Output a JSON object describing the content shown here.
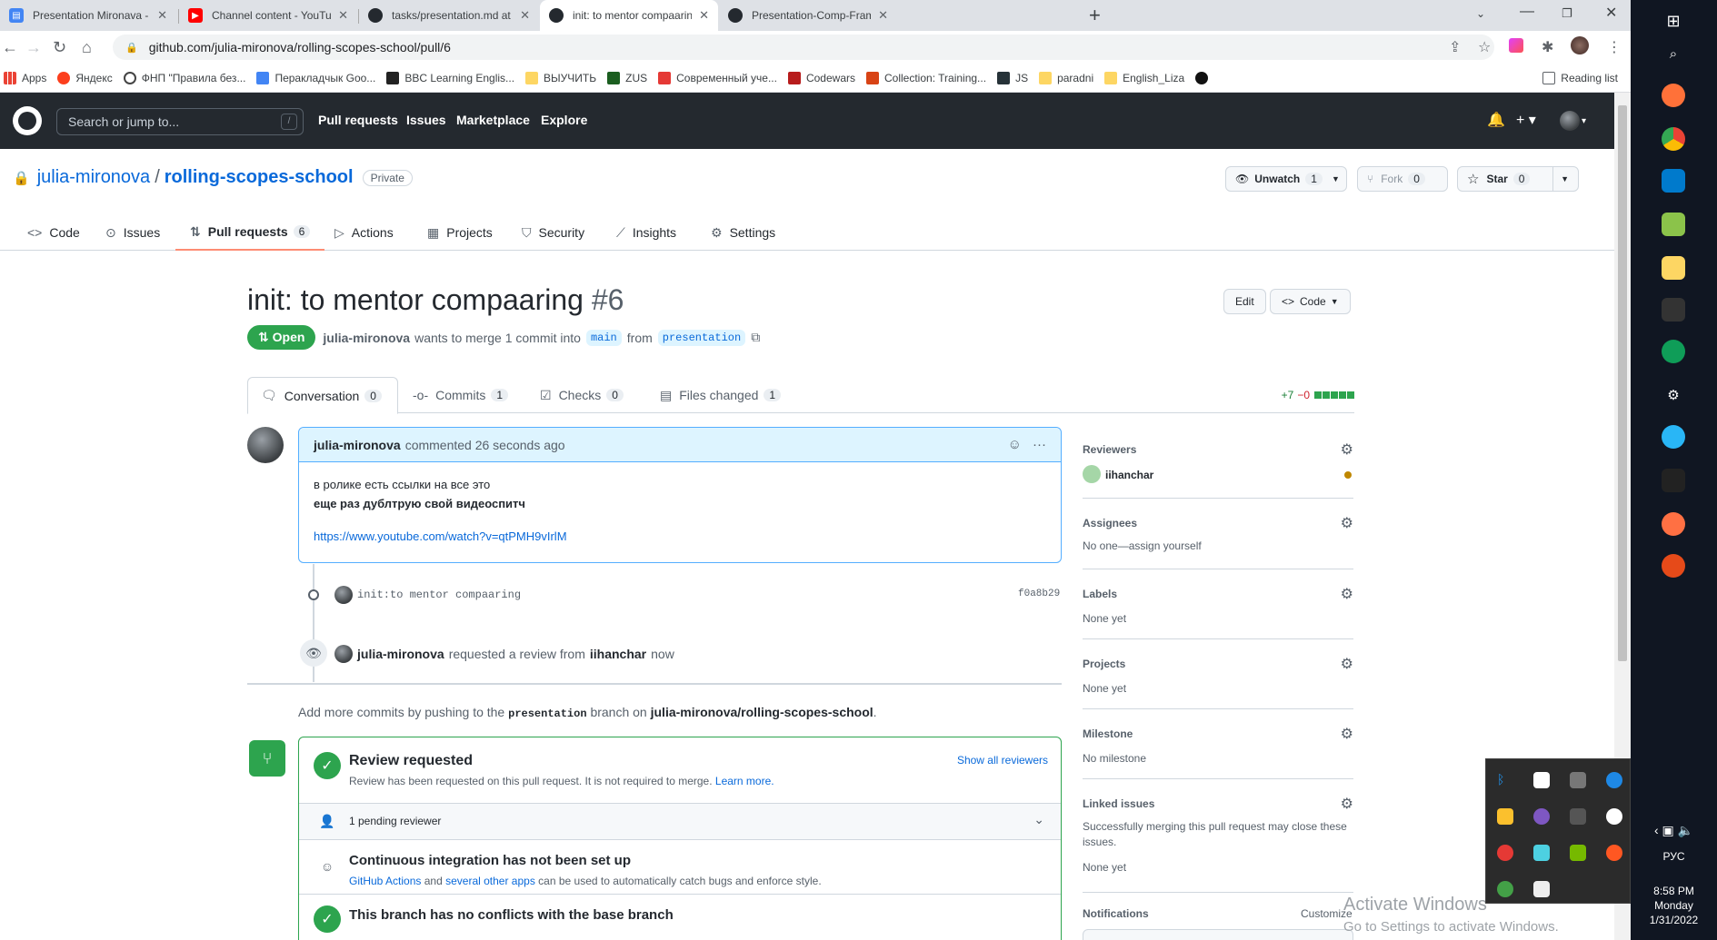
{
  "browser": {
    "tabs": [
      {
        "title": "Presentation Mironava - Google",
        "icon": "docs-icon",
        "color": "#4285f4"
      },
      {
        "title": "Channel content - YouTube Studi",
        "icon": "youtube-icon",
        "color": "#ff0000"
      },
      {
        "title": "tasks/presentation.md at master",
        "icon": "github-icon",
        "color": "#24292f"
      },
      {
        "title": "init: to mentor compaaring by ju",
        "icon": "github-icon",
        "color": "#24292f"
      },
      {
        "title": "Presentation-Comp-Frameworks",
        "icon": "github-icon",
        "color": "#24292f"
      }
    ],
    "url": "github.com/julia-mironova/rolling-scopes-school/pull/6",
    "bookmarks": [
      "Apps",
      "Яндекс",
      "ФНП \"Правила без...",
      "Перакладчык Goo...",
      "BBC Learning Englis...",
      "ВЫУЧИТЬ",
      "ZUS",
      "Современный уче...",
      "Codewars",
      "Collection: Training...",
      "JS",
      "paradni",
      "English_Liza"
    ],
    "reading_list": "Reading list"
  },
  "github": {
    "search_placeholder": "Search or jump to...",
    "search_shortcut": "/",
    "nav": [
      "Pull requests",
      "Issues",
      "Marketplace",
      "Explore"
    ]
  },
  "repo": {
    "owner": "julia-mironova",
    "separator": "/",
    "name": "rolling-scopes-school",
    "visibility": "Private",
    "unwatch_label": "Unwatch",
    "unwatch_count": "1",
    "fork_label": "Fork",
    "fork_count": "0",
    "star_label": "Star",
    "star_count": "0",
    "tabs": [
      {
        "label": "Code",
        "icon": "code-icon"
      },
      {
        "label": "Issues",
        "icon": "issue-icon"
      },
      {
        "label": "Pull requests",
        "icon": "pr-icon",
        "count": "6"
      },
      {
        "label": "Actions",
        "icon": "play-icon"
      },
      {
        "label": "Projects",
        "icon": "table-icon"
      },
      {
        "label": "Security",
        "icon": "shield-icon"
      },
      {
        "label": "Insights",
        "icon": "graph-icon"
      },
      {
        "label": "Settings",
        "icon": "gear-icon"
      }
    ]
  },
  "pr": {
    "title": "init: to mentor compaaring",
    "number": "#6",
    "edit_label": "Edit",
    "code_label": "Code",
    "state": "Open",
    "author": "julia-mironova",
    "merge_text": "wants to merge 1 commit into",
    "base": "main",
    "from_text": "from",
    "head": "presentation",
    "tabs": [
      {
        "label": "Conversation",
        "count": "0"
      },
      {
        "label": "Commits",
        "count": "1"
      },
      {
        "label": "Checks",
        "count": "0"
      },
      {
        "label": "Files changed",
        "count": "1"
      }
    ],
    "additions": "+7",
    "deletions": "−0"
  },
  "comment": {
    "author": "julia-mironova",
    "action": "commented 26 seconds ago",
    "line1": "в ролике есть ссылки на все это",
    "line2": "еще раз дублтрую свой видеоспитч",
    "link": "https://www.youtube.com/watch?v=qtPMH9vIrlM"
  },
  "timeline": {
    "commit_message": "init:to mentor compaaring",
    "commit_sha": "f0a8b29",
    "review_actor": "julia-mironova",
    "review_text": "requested a review from",
    "reviewer": "iihanchar",
    "review_time": "now"
  },
  "hint": {
    "prefix": "Add more commits by pushing to the",
    "branch": "presentation",
    "middle": "branch on",
    "repo": "julia-mironova/rolling-scopes-school",
    "suffix": "."
  },
  "merge": {
    "review_title": "Review requested",
    "review_sub": "Review has been requested on this pull request. It is not required to merge.",
    "learn_more": "Learn more.",
    "show_all": "Show all reviewers",
    "pending": "1 pending reviewer",
    "ci_title": "Continuous integration has not been set up",
    "ci_link1": "GitHub Actions",
    "ci_and": "and",
    "ci_link2": "several other apps",
    "ci_rest": "can be used to automatically catch bugs and enforce style.",
    "conflict_title": "This branch has no conflicts with the base branch"
  },
  "sidebar": {
    "reviewers_h": "Reviewers",
    "reviewer": "iihanchar",
    "assignees_h": "Assignees",
    "assignees_v": "No one—assign yourself",
    "labels_h": "Labels",
    "labels_v": "None yet",
    "projects_h": "Projects",
    "projects_v": "None yet",
    "milestone_h": "Milestone",
    "milestone_v": "No milestone",
    "linked_h": "Linked issues",
    "linked_desc": "Successfully merging this pull request may close these issues.",
    "linked_v": "None yet",
    "notifications_h": "Notifications",
    "customize": "Customize"
  },
  "taskbar": {
    "lang": "РУС",
    "time": "8:58 PM",
    "day": "Monday",
    "date": "1/31/2022"
  },
  "watermark": {
    "line1": "Activate Windows",
    "line2": "Go to Settings to activate Windows."
  }
}
